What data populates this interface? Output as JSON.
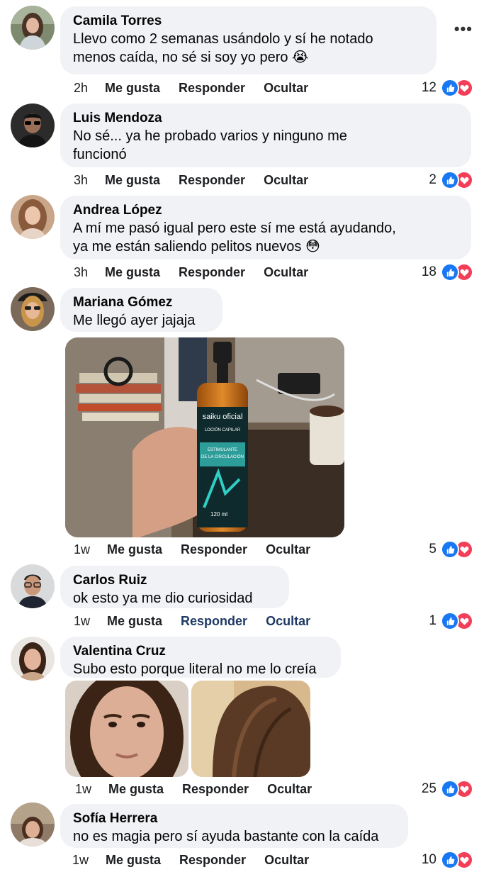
{
  "comments": [
    {
      "author": "Camila Torres",
      "text_lines": [
        "Llevo como 2 semanas usándolo y sí he notado",
        "menos caída, no sé si soy yo pero 😭"
      ],
      "time": "2h",
      "like": "Me gusta",
      "reply": "Responder",
      "hide": "Ocultar",
      "reactions": "12"
    },
    {
      "author": "Luis Mendoza",
      "text_lines": [
        "No sé... ya he probado varios y ninguno me",
        "funcionó"
      ],
      "time": "3h",
      "like": "Me gusta",
      "reply": "Responder",
      "hide": "Ocultar",
      "reactions": "2"
    },
    {
      "author": "Andrea López",
      "text_lines": [
        "A mí me pasó igual pero este sí me está ayudando,",
        "ya me están saliendo pelitos nuevos 😳"
      ],
      "time": "3h",
      "like": "Me gusta",
      "reply": "Responder",
      "hide": "Ocultar",
      "reactions": "18"
    },
    {
      "author": "Mariana Gómez",
      "text_lines": [
        "Me llegó ayer jajaja"
      ],
      "time": "1w",
      "like": "Me gusta",
      "reply": "Responder",
      "hide": "Ocultar",
      "reactions": "5",
      "photo": {
        "brand": "saiku oficial",
        "subtitle": "LOCIÓN CAPILAR",
        "label": [
          "ESTIMULANTE",
          "DE LA CIRCULACIÓN"
        ],
        "volume": "120 ml"
      }
    },
    {
      "author": "Carlos Ruiz",
      "text_lines": [
        "ok  esto ya me dio curiosidad"
      ],
      "time": "1w",
      "like": "Me gusta",
      "reply": "Responder",
      "hide": "Ocultar",
      "reactions": "1"
    },
    {
      "author": "Valentina Cruz",
      "text_lines": [
        "Subo esto porque literal no me lo creía"
      ],
      "time": "1w",
      "like": "Me gusta",
      "reply": "Responder",
      "hide": "Ocultar",
      "reactions": "25"
    },
    {
      "author": "Sofía Herrera",
      "text_lines": [
        "no es magia pero sí ayuda bastante con la caída"
      ],
      "time": "1w",
      "like": "Me gusta",
      "reply": "Responder",
      "hide": "Ocultar",
      "reactions": "10"
    }
  ],
  "icons": {
    "more": "more-options-icon",
    "like": "like-reaction-icon",
    "love": "love-reaction-icon"
  },
  "colors": {
    "bubble": "#f0f2f5",
    "like_blue": "#1877f2",
    "love_red": "#f33e58",
    "reply_link": "#1e3a64"
  }
}
